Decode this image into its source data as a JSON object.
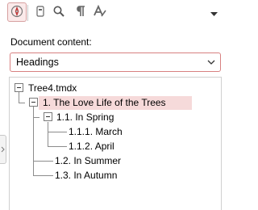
{
  "toolbar": {
    "buttons": [
      {
        "icon": "compass-icon",
        "active": true
      },
      {
        "icon": "page-icon"
      },
      {
        "icon": "search-icon"
      },
      {
        "icon": "pilcrow-icon"
      },
      {
        "icon": "text-style-icon"
      }
    ],
    "menu_icon": "caret-down-icon"
  },
  "document_content": {
    "label": "Document content:",
    "selected": "Headings"
  },
  "tree": {
    "root": "Tree4.tmdx",
    "items": [
      {
        "label": "1. The Love Life of the Trees",
        "selected": true
      },
      {
        "label": "1.1. In Spring"
      },
      {
        "label": "1.1.1. March"
      },
      {
        "label": "1.1.2. April"
      },
      {
        "label": "1.2. In Summer"
      },
      {
        "label": "1.3. In Autumn"
      }
    ]
  },
  "colors": {
    "accent": "#d88080",
    "selection": "#f6dada",
    "icon": "#666666",
    "compass_red": "#d33b3b"
  }
}
